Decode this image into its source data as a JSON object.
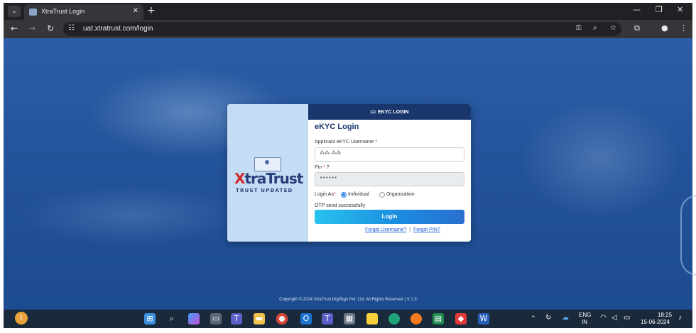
{
  "browser": {
    "tab_title": "XtraTrust Login",
    "tab_close": "✕",
    "new_tab": "+",
    "tab_menu": "⌄",
    "window_controls": [
      "—",
      "❐",
      "✕"
    ],
    "url": "uat.xtratrust.com/login",
    "nav": {
      "back": "←",
      "forward": "→",
      "reload": "↻"
    },
    "icons": {
      "site_info": "site-info-icon",
      "password": "key-icon",
      "zoom": "zoom-icon",
      "bookmark": "star-icon",
      "extensions": "puzzle-icon",
      "profile": "profile-icon",
      "menu": "kebab-menu-icon"
    }
  },
  "logo": {
    "brand": "XtraTrust",
    "brand_first": "X",
    "brand_rest": "traTrust",
    "tagline": "TRUST UPDATED"
  },
  "login_card": {
    "header": "EKYC LOGIN",
    "title": "eKYC Login",
    "username_label": "Applicant eKYC Username",
    "required_mark": "*",
    "username_value": "⁂⁂ ⁂⁂",
    "pin_label": "Pin",
    "pin_help": "?",
    "pin_value": "••••••",
    "login_as_label": "Login As",
    "login_as_options": [
      {
        "label": "Individual",
        "selected": true
      },
      {
        "label": "Organization",
        "selected": false
      }
    ],
    "status_message": "OTP send successfully",
    "login_button": "Login",
    "forgot_username": "Forgot Username?",
    "separator": "|",
    "forgot_pin": "Forgot PIN?"
  },
  "footer": {
    "copyright": "Copyright © 2024 XtraTrust DigiSign Pvt. Ltd. All Rights Reserved | V 1.3"
  },
  "taskbar": {
    "apps": [
      "start-icon",
      "search-icon",
      "copilot-icon",
      "task-view-icon",
      "teams-icon",
      "explorer-icon",
      "chrome-icon",
      "outlook-icon",
      "teams-work-icon",
      "calculator-icon",
      "sticky-notes-icon",
      "edge-icon",
      "firefox-icon",
      "excel-icon",
      "anydesk-icon",
      "word-icon"
    ],
    "language": "ENG",
    "region": "IN",
    "time": "18:25",
    "date": "15-06-2024",
    "notification_badge": "1"
  },
  "colors": {
    "card_header": "#19376d",
    "login_button": "#1b8de0",
    "page_background": "#23539a",
    "taskbar": "#1b2a3a"
  }
}
